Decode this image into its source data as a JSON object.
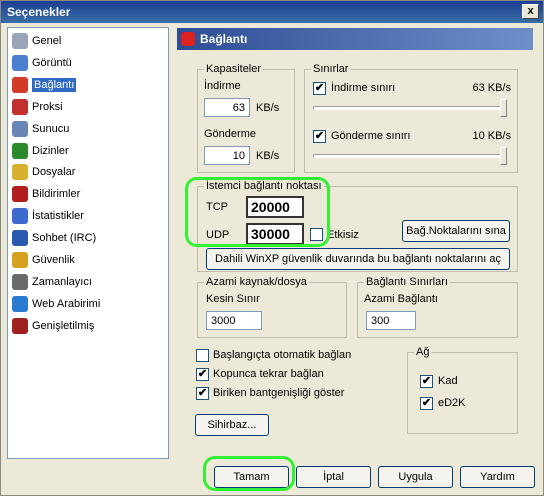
{
  "window": {
    "title": "Seçenekler",
    "close_glyph": "x"
  },
  "sidebar": {
    "items": [
      {
        "label": "Genel",
        "icon": "gear-icon",
        "color": "#9aa4b8"
      },
      {
        "label": "Görüntü",
        "icon": "display-icon",
        "color": "#4b7fd0"
      },
      {
        "label": "Bağlantı",
        "icon": "connection-icon",
        "color": "#d23a2a"
      },
      {
        "label": "Proksi",
        "icon": "proxy-icon",
        "color": "#c03030"
      },
      {
        "label": "Sunucu",
        "icon": "server-icon",
        "color": "#6a86b6"
      },
      {
        "label": "Dizinler",
        "icon": "folder-icon",
        "color": "#2a8a2a"
      },
      {
        "label": "Dosyalar",
        "icon": "files-icon",
        "color": "#d8b030"
      },
      {
        "label": "Bildirimler",
        "icon": "notification-icon",
        "color": "#b02020"
      },
      {
        "label": "İstatistikler",
        "icon": "stats-icon",
        "color": "#3a6ad0"
      },
      {
        "label": "Sohbet (IRC)",
        "icon": "chat-icon",
        "color": "#2a5ab0"
      },
      {
        "label": "Güvenlik",
        "icon": "lock-icon",
        "color": "#d8a020"
      },
      {
        "label": "Zamanlayıcı",
        "icon": "clock-icon",
        "color": "#6a6a6a"
      },
      {
        "label": "Web Arabirimi",
        "icon": "globe-icon",
        "color": "#2a7ad0"
      },
      {
        "label": "Genişletilmiş",
        "icon": "puzzle-icon",
        "color": "#a02020"
      }
    ],
    "active_index": 2
  },
  "header": {
    "title": "Bağlantı"
  },
  "kapasiteler": {
    "legend": "Kapasiteler",
    "indirme_label": "İndirme",
    "indirme_value": "63",
    "indirme_unit": "KB/s",
    "gonderme_label": "Gönderme",
    "gonderme_value": "10",
    "gonderme_unit": "KB/s"
  },
  "sinirlar": {
    "legend": "Sınırlar",
    "indirme_label": "İndirme sınırı",
    "indirme_value": "63 KB/s",
    "indirme_checked": true,
    "indirme_level": 1.0,
    "gonderme_label": "Gönderme sınırı",
    "gonderme_value": "10 KB/s",
    "gonderme_checked": true,
    "gonderme_level": 1.0
  },
  "client_ports": {
    "legend": "İstemci bağlantı noktası",
    "tcp_label": "TCP",
    "tcp_value": "20000",
    "udp_label": "UDP",
    "udp_value": "30000",
    "disabled_label": "Etkisiz",
    "disabled_checked": false,
    "test_button": "Bağ.Noktalarını sına",
    "firewall_button": "Dahili WinXP güvenlik duvarında bu bağlantı noktalarını aç"
  },
  "max_sources": {
    "legend": "Azami kaynak/dosya",
    "label": "Kesin Sınır",
    "value": "3000"
  },
  "conn_limits": {
    "legend": "Bağlantı Sınırları",
    "label": "Azami Bağlantı",
    "value": "300"
  },
  "options": [
    {
      "label": "Başlangıçta otomatik bağlan",
      "checked": false
    },
    {
      "label": "Kopunca tekrar bağlan",
      "checked": true
    },
    {
      "label": "Biriken bantgenişliği göster",
      "checked": true
    }
  ],
  "network": {
    "legend": "Ağ",
    "kad_label": "Kad",
    "kad_checked": true,
    "ed2k_label": "eD2K",
    "ed2k_checked": true
  },
  "wizard_button": "Sihirbaz...",
  "footer": {
    "ok": "Tamam",
    "cancel": "İptal",
    "apply": "Uygula",
    "help": "Yardım"
  },
  "check_glyph": "✔",
  "colors": {
    "highlight": "#32f032",
    "selection": "#316ac5"
  }
}
